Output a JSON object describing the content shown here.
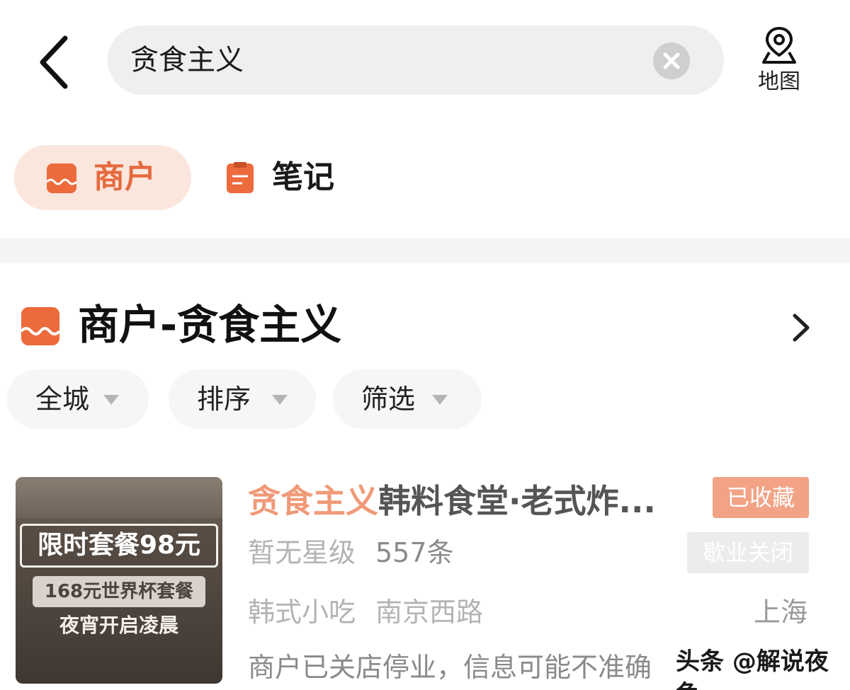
{
  "search": {
    "query": "贪食主义"
  },
  "map": {
    "label": "地图"
  },
  "tabs": [
    {
      "label": "商户",
      "active": true
    },
    {
      "label": "笔记",
      "active": false
    }
  ],
  "section": {
    "title": "商户-贪食主义"
  },
  "filters": [
    {
      "label": "全城"
    },
    {
      "label": "排序"
    },
    {
      "label": "筛选"
    }
  ],
  "result": {
    "title_highlight": "贪食主义",
    "title_rest": "韩料食堂·老式炸...",
    "badge_favorited": "已收藏",
    "badge_status": "歇业关闭",
    "rating": "暂无星级",
    "review_count": "557条",
    "category": "韩式小吃",
    "area": "南京西路",
    "city": "上海",
    "notice": "商户已关店停业，信息可能不准确",
    "thumbnail": {
      "promo": "限时套餐98元",
      "sub": "168元世界杯套餐",
      "sub2": "夜宵开启凌晨"
    }
  },
  "watermark": "头条 @解说夜色",
  "colors": {
    "accent": "#e46a3e",
    "highlight": "#f09a78",
    "badge_fav": "#f2a386"
  }
}
